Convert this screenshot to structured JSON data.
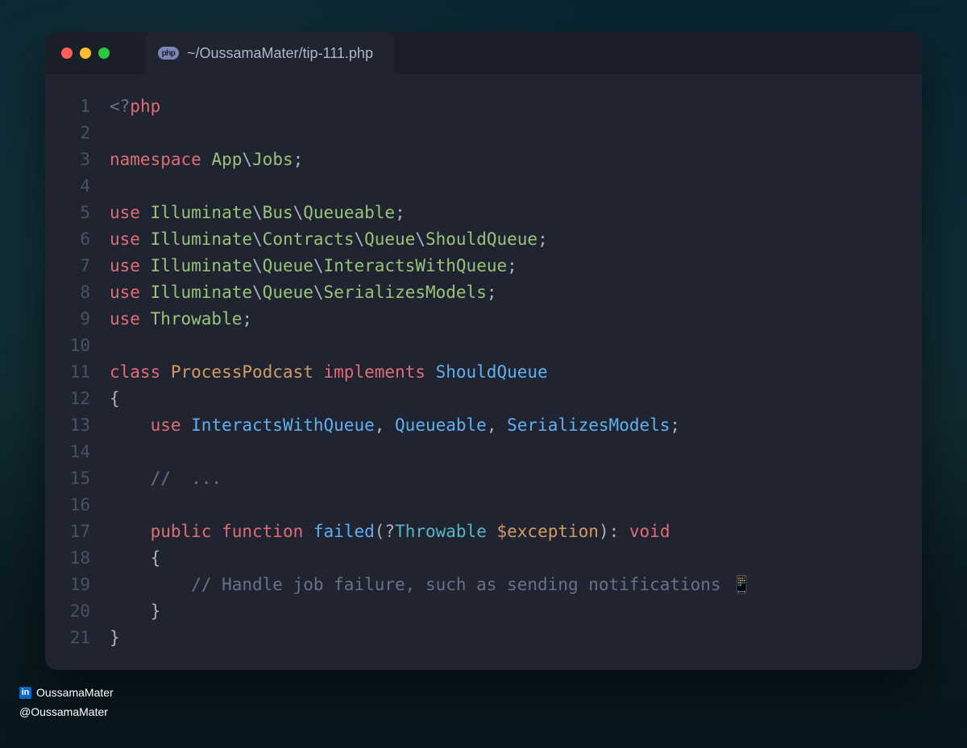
{
  "tab_title": "~/OussamaMater/tip-111.php",
  "tab_badge": "php",
  "footer": {
    "linkedin": "OussamaMater",
    "handle": "@OussamaMater"
  },
  "code_lines": [
    {
      "n": 1,
      "tokens": [
        {
          "t": "<?",
          "c": "gray"
        },
        {
          "t": "php",
          "c": "red"
        }
      ]
    },
    {
      "n": 2,
      "tokens": []
    },
    {
      "n": 3,
      "tokens": [
        {
          "t": "namespace ",
          "c": "red"
        },
        {
          "t": "App",
          "c": "green"
        },
        {
          "t": "\\",
          "c": "default"
        },
        {
          "t": "Jobs",
          "c": "green"
        },
        {
          "t": ";",
          "c": "default"
        }
      ]
    },
    {
      "n": 4,
      "tokens": []
    },
    {
      "n": 5,
      "tokens": [
        {
          "t": "use ",
          "c": "red"
        },
        {
          "t": "Illuminate",
          "c": "green"
        },
        {
          "t": "\\",
          "c": "default"
        },
        {
          "t": "Bus",
          "c": "green"
        },
        {
          "t": "\\",
          "c": "default"
        },
        {
          "t": "Queueable",
          "c": "green"
        },
        {
          "t": ";",
          "c": "default"
        }
      ]
    },
    {
      "n": 6,
      "tokens": [
        {
          "t": "use ",
          "c": "red"
        },
        {
          "t": "Illuminate",
          "c": "green"
        },
        {
          "t": "\\",
          "c": "default"
        },
        {
          "t": "Contracts",
          "c": "green"
        },
        {
          "t": "\\",
          "c": "default"
        },
        {
          "t": "Queue",
          "c": "green"
        },
        {
          "t": "\\",
          "c": "default"
        },
        {
          "t": "ShouldQueue",
          "c": "green"
        },
        {
          "t": ";",
          "c": "default"
        }
      ]
    },
    {
      "n": 7,
      "tokens": [
        {
          "t": "use ",
          "c": "red"
        },
        {
          "t": "Illuminate",
          "c": "green"
        },
        {
          "t": "\\",
          "c": "default"
        },
        {
          "t": "Queue",
          "c": "green"
        },
        {
          "t": "\\",
          "c": "default"
        },
        {
          "t": "InteractsWithQueue",
          "c": "green"
        },
        {
          "t": ";",
          "c": "default"
        }
      ]
    },
    {
      "n": 8,
      "tokens": [
        {
          "t": "use ",
          "c": "red"
        },
        {
          "t": "Illuminate",
          "c": "green"
        },
        {
          "t": "\\",
          "c": "default"
        },
        {
          "t": "Queue",
          "c": "green"
        },
        {
          "t": "\\",
          "c": "default"
        },
        {
          "t": "SerializesModels",
          "c": "green"
        },
        {
          "t": ";",
          "c": "default"
        }
      ]
    },
    {
      "n": 9,
      "tokens": [
        {
          "t": "use ",
          "c": "red"
        },
        {
          "t": "Throwable",
          "c": "green"
        },
        {
          "t": ";",
          "c": "default"
        }
      ]
    },
    {
      "n": 10,
      "tokens": []
    },
    {
      "n": 11,
      "tokens": [
        {
          "t": "class ",
          "c": "red"
        },
        {
          "t": "ProcessPodcast ",
          "c": "orange"
        },
        {
          "t": "implements ",
          "c": "red"
        },
        {
          "t": "ShouldQueue",
          "c": "blue"
        }
      ]
    },
    {
      "n": 12,
      "tokens": [
        {
          "t": "{",
          "c": "default"
        }
      ]
    },
    {
      "n": 13,
      "tokens": [
        {
          "t": "    ",
          "c": "default"
        },
        {
          "t": "use ",
          "c": "red"
        },
        {
          "t": "InteractsWithQueue",
          "c": "blue"
        },
        {
          "t": ", ",
          "c": "default"
        },
        {
          "t": "Queueable",
          "c": "blue"
        },
        {
          "t": ", ",
          "c": "default"
        },
        {
          "t": "SerializesModels",
          "c": "blue"
        },
        {
          "t": ";",
          "c": "default"
        }
      ]
    },
    {
      "n": 14,
      "tokens": []
    },
    {
      "n": 15,
      "tokens": [
        {
          "t": "    ",
          "c": "default"
        },
        {
          "t": "//  ...",
          "c": "gray"
        }
      ]
    },
    {
      "n": 16,
      "tokens": []
    },
    {
      "n": 17,
      "tokens": [
        {
          "t": "    ",
          "c": "default"
        },
        {
          "t": "public ",
          "c": "red"
        },
        {
          "t": "function ",
          "c": "red"
        },
        {
          "t": "failed",
          "c": "blue"
        },
        {
          "t": "(",
          "c": "default"
        },
        {
          "t": "?",
          "c": "default"
        },
        {
          "t": "Throwable ",
          "c": "cyan"
        },
        {
          "t": "$exception",
          "c": "orange"
        },
        {
          "t": ")",
          "c": "default"
        },
        {
          "t": ": ",
          "c": "default"
        },
        {
          "t": "void",
          "c": "red"
        }
      ]
    },
    {
      "n": 18,
      "tokens": [
        {
          "t": "    {",
          "c": "default"
        }
      ]
    },
    {
      "n": 19,
      "tokens": [
        {
          "t": "        ",
          "c": "default"
        },
        {
          "t": "// Handle job failure, such as sending notifications 📱",
          "c": "gray"
        }
      ]
    },
    {
      "n": 20,
      "tokens": [
        {
          "t": "    }",
          "c": "default"
        }
      ]
    },
    {
      "n": 21,
      "tokens": [
        {
          "t": "}",
          "c": "default"
        }
      ]
    }
  ]
}
